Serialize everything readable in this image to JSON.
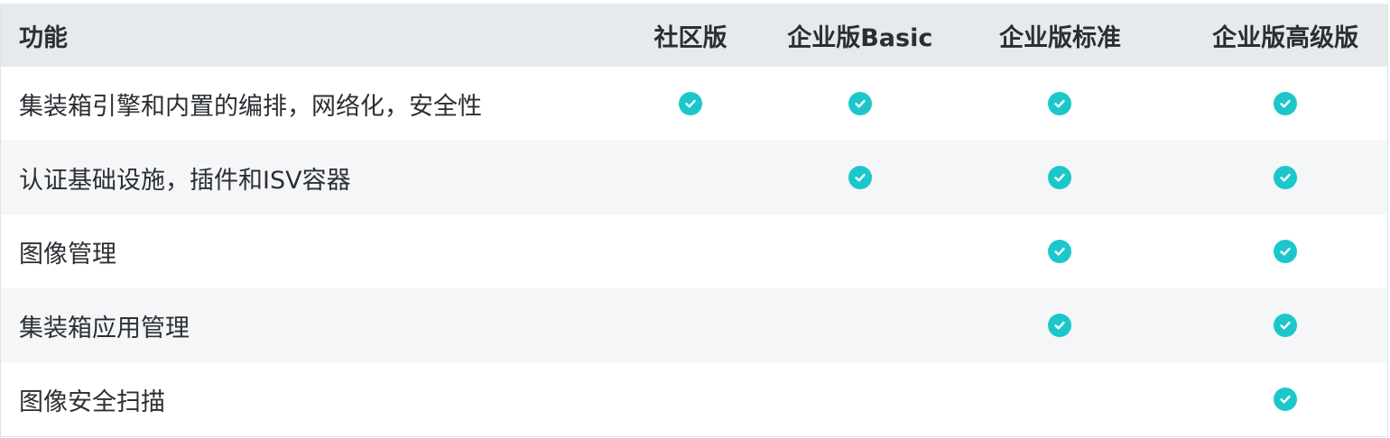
{
  "header": {
    "feature_label": "功能",
    "columns": [
      "社区版",
      "企业版Basic",
      "企业版标准",
      "企业版高级版"
    ]
  },
  "rows": [
    {
      "feature": "集装箱引擎和内置的编排，网络化，安全性",
      "checks": [
        true,
        true,
        true,
        true
      ]
    },
    {
      "feature": "认证基础设施，插件和ISV容器",
      "checks": [
        false,
        true,
        true,
        true
      ]
    },
    {
      "feature": "图像管理",
      "checks": [
        false,
        false,
        true,
        true
      ]
    },
    {
      "feature": "集装箱应用管理",
      "checks": [
        false,
        false,
        true,
        true
      ]
    },
    {
      "feature": "图像安全扫描",
      "checks": [
        false,
        false,
        false,
        true
      ]
    }
  ],
  "icons": {
    "included": "check-circle-icon"
  },
  "colors": {
    "check": "#1cc7cb",
    "header_bg": "#e6eaec",
    "stripe_bg": "#f5f6f7"
  }
}
